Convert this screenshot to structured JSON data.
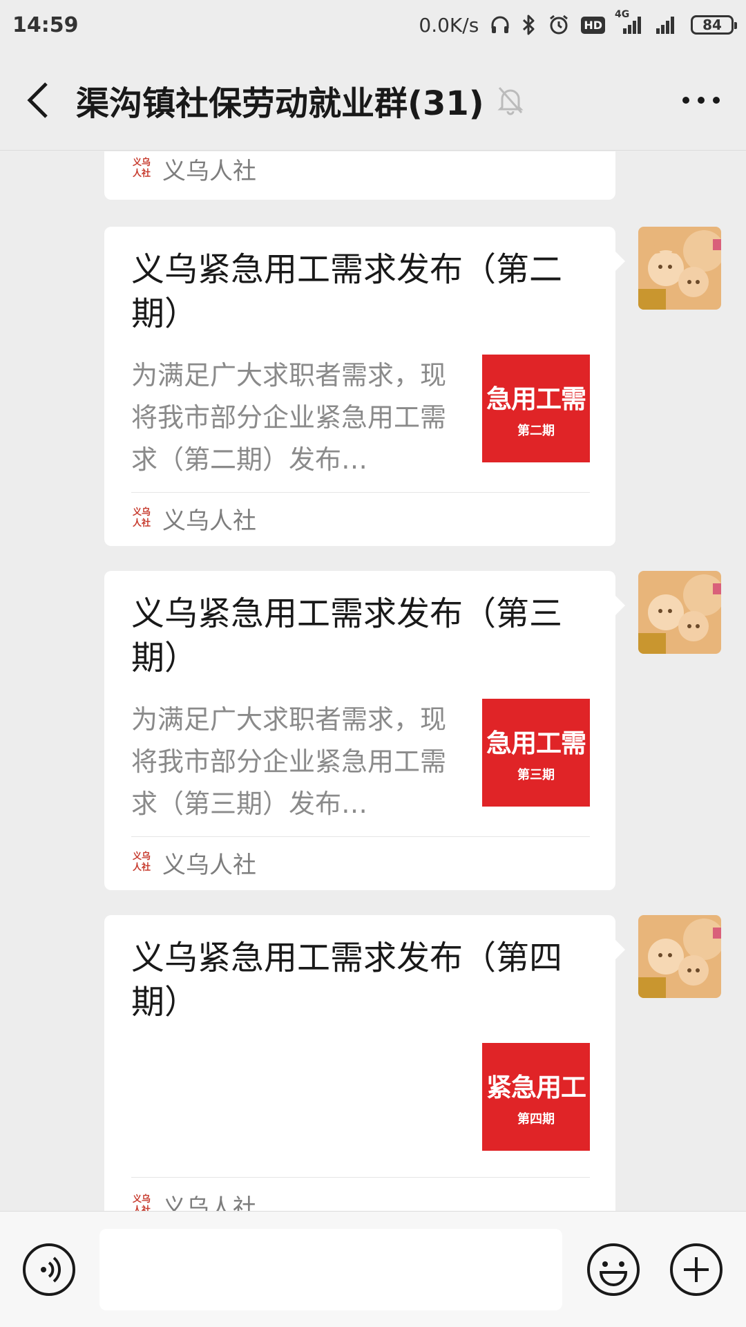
{
  "status_bar": {
    "time": "14:59",
    "speed": "0.0K/s",
    "network": "4G",
    "hd": "HD",
    "battery": "84",
    "icons": [
      "headphones-icon",
      "bluetooth-icon",
      "alarm-icon",
      "hd-icon",
      "signal-4g-icon",
      "signal-icon",
      "battery-icon"
    ]
  },
  "header": {
    "title": "渠沟镇社保劳动就业群(31)",
    "icons": [
      "back-arrow-icon",
      "mute-bell-icon",
      "more-dots-icon"
    ]
  },
  "messages": [
    {
      "partial": true,
      "source": "义乌人社"
    },
    {
      "title": "义乌紧急用工需求发布（第二期）",
      "desc": "为满足广大求职者需求，现将我市部分企业紧急用工需求（第二期）发布…",
      "thumb_main": "急用工需",
      "thumb_sub": "第二期",
      "source": "义乌人社"
    },
    {
      "title": "义乌紧急用工需求发布（第三期）",
      "desc": "为满足广大求职者需求，现将我市部分企业紧急用工需求（第三期）发布…",
      "thumb_main": "急用工需",
      "thumb_sub": "第三期",
      "source": "义乌人社"
    },
    {
      "title": "义乌紧急用工需求发布（第四期）",
      "desc": "",
      "thumb_main": "紧急用工",
      "thumb_sub": "第四期",
      "source": "义乌人社"
    }
  ],
  "source_logo_text": "义乌人社",
  "input_bar": {
    "value": "",
    "icons": [
      "voice-icon",
      "emoji-icon",
      "plus-icon"
    ]
  },
  "colors": {
    "background": "#ededed",
    "card": "#ffffff",
    "thumb_red": "#e02427",
    "logo_red": "#c73b2e",
    "text_primary": "#191919",
    "text_secondary": "#8a8a8a"
  }
}
